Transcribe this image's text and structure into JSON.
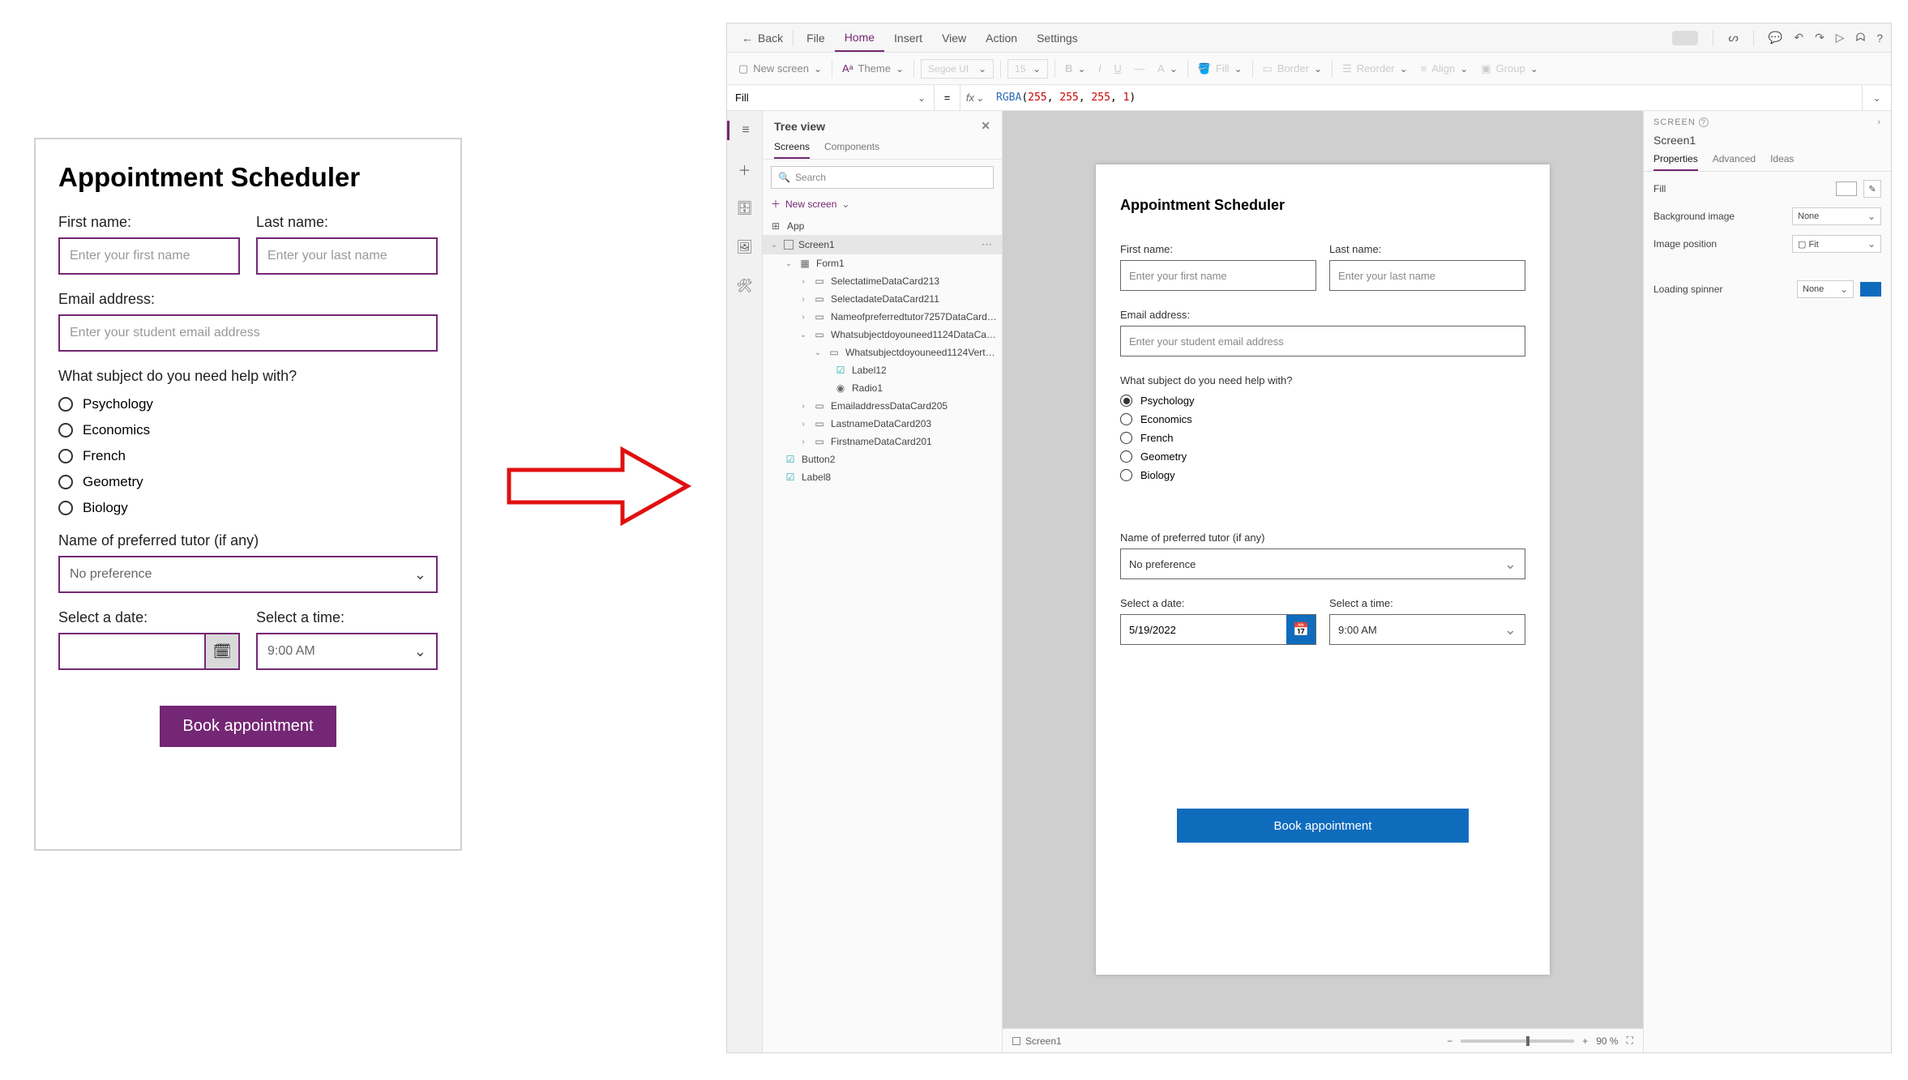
{
  "mockup": {
    "title": "Appointment Scheduler",
    "first_name_label": "First name:",
    "first_name_ph": "Enter your first name",
    "last_name_label": "Last name:",
    "last_name_ph": "Enter your last name",
    "email_label": "Email address:",
    "email_ph": "Enter your student email address",
    "subject_label": "What subject do you need help with?",
    "subjects": [
      "Psychology",
      "Economics",
      "French",
      "Geometry",
      "Biology"
    ],
    "tutor_label": "Name of preferred tutor (if any)",
    "tutor_value": "No preference",
    "date_label": "Select a date:",
    "time_label": "Select a time:",
    "time_value": "9:00 AM",
    "book_btn": "Book appointment"
  },
  "menu": {
    "back": "Back",
    "items": [
      "File",
      "Home",
      "Insert",
      "View",
      "Action",
      "Settings"
    ],
    "active_index": 1
  },
  "ribbon": {
    "new_screen": "New screen",
    "theme": "Theme",
    "font": "Segoe UI",
    "size": "15",
    "fill": "Fill",
    "border": "Border",
    "reorder": "Reorder",
    "align": "Align",
    "group": "Group"
  },
  "fx": {
    "property": "Fill",
    "formula_func": "RGBA",
    "formula_args": [
      "255",
      "255",
      "255",
      "1"
    ]
  },
  "tree": {
    "title": "Tree view",
    "tabs": [
      "Screens",
      "Components"
    ],
    "search_ph": "Search",
    "new_screen": "New screen",
    "app": "App",
    "screen": "Screen1",
    "form": "Form1",
    "nodes": [
      "SelectatimeDataCard213",
      "SelectadateDataCard211",
      "Nameofpreferredtutor7257DataCard…",
      "Whatsubjectdoyouneed1124DataCar…",
      "Whatsubjectdoyouneed1124Vert…",
      "Label12",
      "Radio1",
      "EmailaddressDataCard205",
      "LastnameDataCard203",
      "FirstnameDataCard201"
    ],
    "button2": "Button2",
    "label8": "Label8"
  },
  "canvas": {
    "title": "Appointment Scheduler",
    "first_name_label": "First name:",
    "first_name_ph": "Enter your first name",
    "last_name_label": "Last name:",
    "last_name_ph": "Enter your last name",
    "email_label": "Email address:",
    "email_ph": "Enter your student email address",
    "subject_label": "What subject do you need help with?",
    "subjects": [
      "Psychology",
      "Economics",
      "French",
      "Geometry",
      "Biology"
    ],
    "subject_selected_index": 0,
    "tutor_label": "Name of preferred tutor (if any)",
    "tutor_value": "No preference",
    "date_label": "Select a date:",
    "date_value": "5/19/2022",
    "time_label": "Select a time:",
    "time_value": "9:00 AM",
    "book_btn": "Book appointment"
  },
  "status": {
    "screen": "Screen1",
    "zoom": "90 %"
  },
  "props": {
    "header": "SCREEN",
    "name": "Screen1",
    "tabs": [
      "Properties",
      "Advanced",
      "Ideas"
    ],
    "fill": "Fill",
    "bgimg": "Background image",
    "bgimg_val": "None",
    "imgpos": "Image position",
    "imgpos_val": "Fit",
    "spinner": "Loading spinner",
    "spinner_val": "None"
  }
}
